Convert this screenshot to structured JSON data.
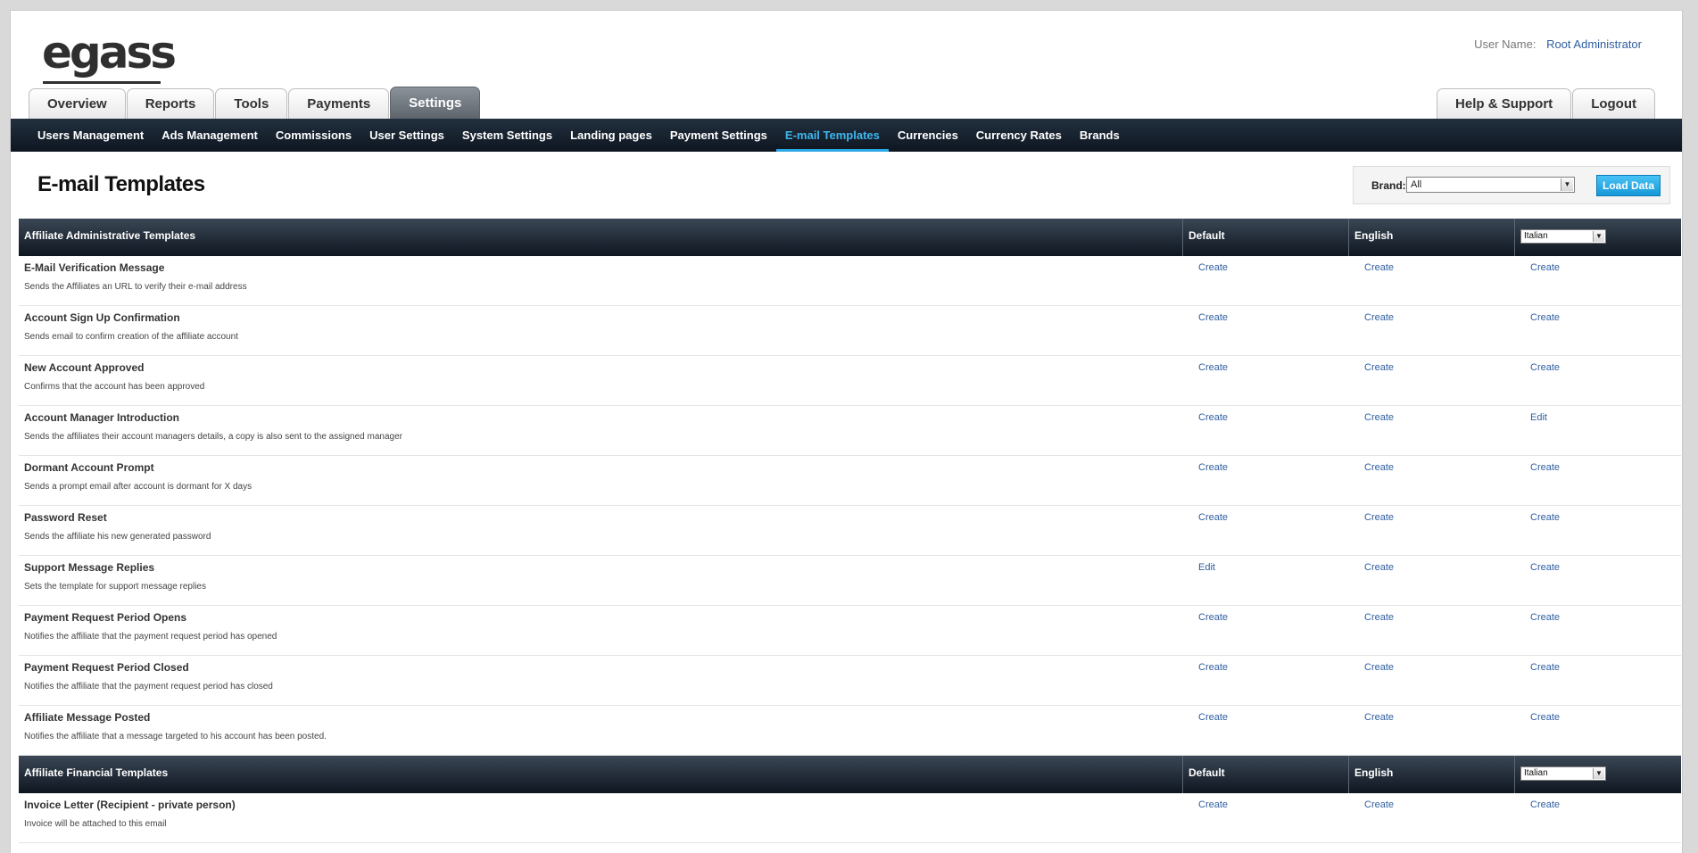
{
  "header": {
    "logo": "egass",
    "user_label": "User Name:",
    "user_name": "Root Administrator"
  },
  "main_tabs": [
    "Overview",
    "Reports",
    "Tools",
    "Payments",
    "Settings"
  ],
  "active_main_tab": "Settings",
  "right_tabs": [
    "Help & Support",
    "Logout"
  ],
  "subnav": [
    "Users Management",
    "Ads Management",
    "Commissions",
    "User Settings",
    "System Settings",
    "Landing pages",
    "Payment Settings",
    "E-mail Templates",
    "Currencies",
    "Currency Rates",
    "Brands"
  ],
  "active_subnav": "E-mail Templates",
  "page": {
    "title": "E-mail Templates",
    "brand_label": "Brand:",
    "brand_value": "All",
    "load_button": "Load Data"
  },
  "sections": [
    {
      "title": "Affiliate Administrative Templates",
      "col_default": "Default",
      "col_english": "English",
      "lang_select": "Italian",
      "rows": [
        {
          "title": "E-Mail Verification Message",
          "desc": "Sends the Affiliates an URL to verify their e-mail address",
          "default": "Create",
          "english": "Create",
          "lang": "Create"
        },
        {
          "title": "Account Sign Up Confirmation",
          "desc": "Sends email to confirm creation of the affiliate account",
          "default": "Create",
          "english": "Create",
          "lang": "Create"
        },
        {
          "title": "New Account Approved",
          "desc": "Confirms that the account has been approved",
          "default": "Create",
          "english": "Create",
          "lang": "Create"
        },
        {
          "title": "Account Manager Introduction",
          "desc": "Sends the affiliates their account managers details, a copy is also sent to the assigned manager",
          "default": "Create",
          "english": "Create",
          "lang": "Edit"
        },
        {
          "title": "Dormant Account Prompt",
          "desc": "Sends a prompt email after account is dormant for X days",
          "default": "Create",
          "english": "Create",
          "lang": "Create"
        },
        {
          "title": "Password Reset",
          "desc": "Sends the affiliate his new generated password",
          "default": "Create",
          "english": "Create",
          "lang": "Create"
        },
        {
          "title": "Support Message Replies",
          "desc": "Sets the template for support message replies",
          "default": "Edit",
          "english": "Create",
          "lang": "Create"
        },
        {
          "title": "Payment Request Period Opens",
          "desc": "Notifies the affiliate that the payment request period has opened",
          "default": "Create",
          "english": "Create",
          "lang": "Create"
        },
        {
          "title": "Payment Request Period Closed",
          "desc": "Notifies the affiliate that the payment request period has closed",
          "default": "Create",
          "english": "Create",
          "lang": "Create"
        },
        {
          "title": "Affiliate Message Posted",
          "desc": "Notifies the affiliate that a message targeted to his account has been posted.",
          "default": "Create",
          "english": "Create",
          "lang": "Create"
        }
      ]
    },
    {
      "title": "Affiliate Financial Templates",
      "col_default": "Default",
      "col_english": "English",
      "lang_select": "Italian",
      "rows": [
        {
          "title": "Invoice Letter (Recipient - private person)",
          "desc": "Invoice will be attached to this email",
          "default": "Create",
          "english": "Create",
          "lang": "Create"
        }
      ]
    }
  ]
}
